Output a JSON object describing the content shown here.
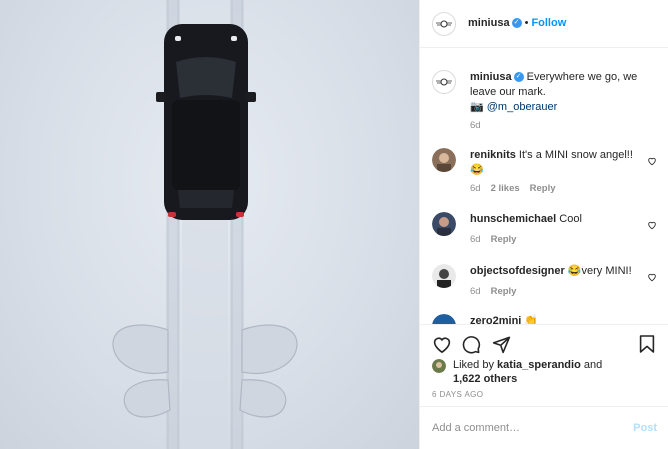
{
  "header": {
    "username": "miniusa",
    "separator": "•",
    "follow_label": "Follow"
  },
  "caption": {
    "username": "miniusa",
    "text": "Everywhere we go, we leave our mark.",
    "credit": "@m_oberauer",
    "time": "6d"
  },
  "comments": [
    {
      "username": "reniknits",
      "text": "It's a MINI snow angel!! 😂",
      "time": "6d",
      "likes": "2 likes",
      "reply": "Reply"
    },
    {
      "username": "hunschemichael",
      "text": "Cool",
      "time": "6d",
      "reply": "Reply"
    },
    {
      "username": "objectsofdesigner",
      "text": "😂very MINI!",
      "time": "6d",
      "reply": "Reply"
    },
    {
      "username": "zero2mini",
      "text": "👏"
    }
  ],
  "likes": {
    "prefix": "Liked by",
    "user": "katia_sperandio",
    "and": "and",
    "count": "1,622 others"
  },
  "post_date": "6 DAYS AGO",
  "add_comment": {
    "placeholder": "Add a comment…",
    "post_label": "Post"
  },
  "colors": {
    "accent": "#0095f6",
    "verified": "#3897f0",
    "post_disabled": "#b2dffc",
    "meta": "#8e8e8e"
  },
  "icons": [
    "heart-icon",
    "comment-icon",
    "share-icon",
    "bookmark-icon",
    "camera-icon",
    "verified-icon"
  ]
}
